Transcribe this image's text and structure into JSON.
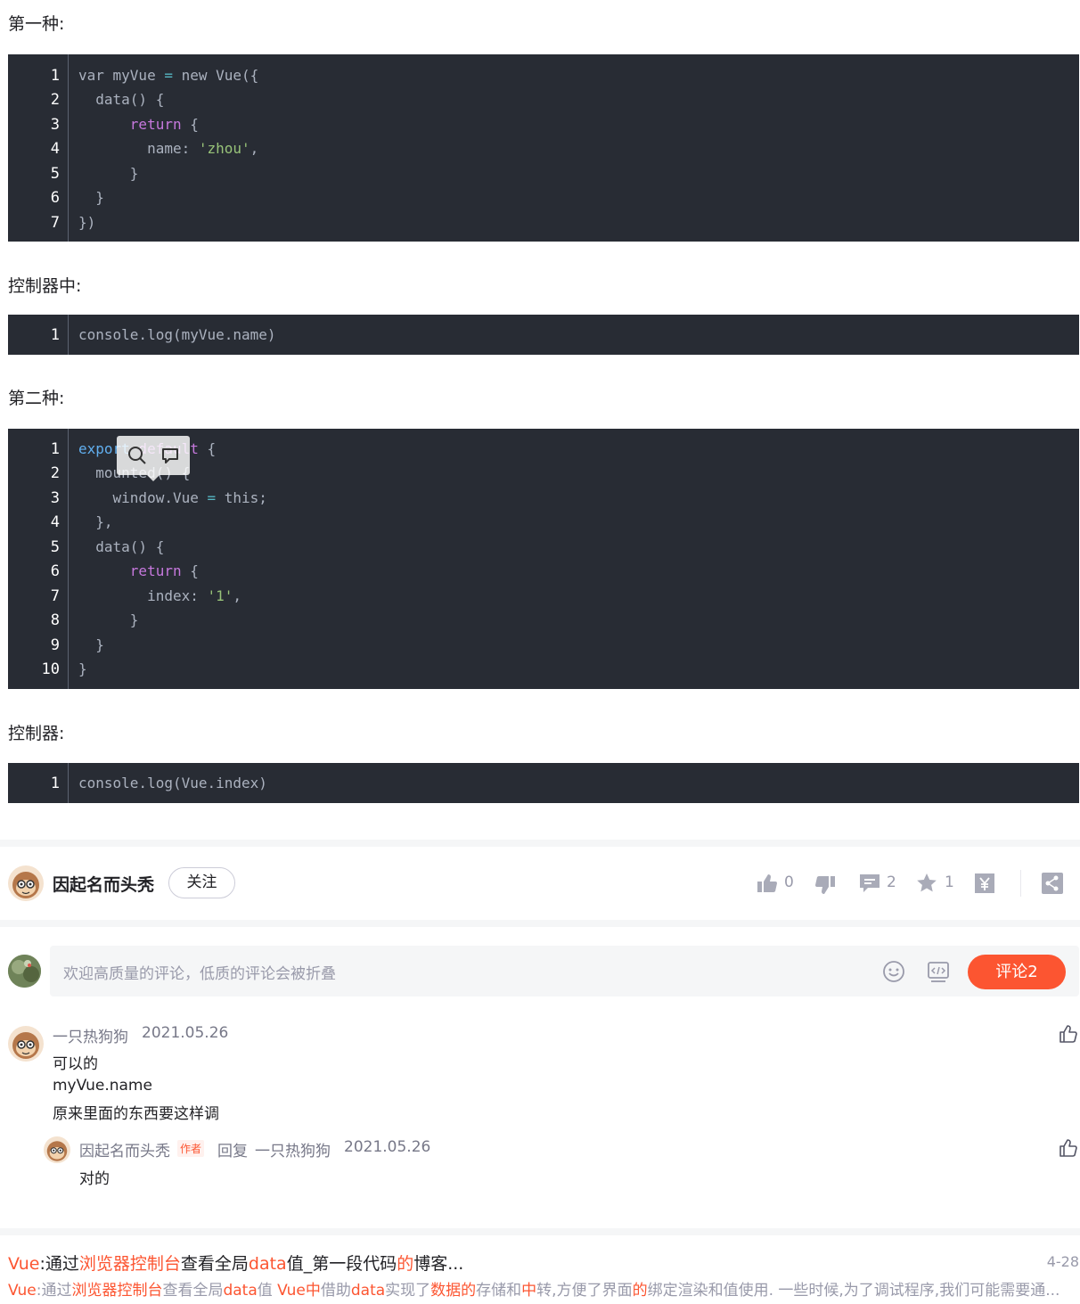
{
  "paragraphs": {
    "p1": "第一种:",
    "p2": "控制器中:",
    "p3": "第二种:",
    "p4": "控制器:"
  },
  "code_blocks": [
    {
      "lines": [
        "1",
        "2",
        "3",
        "4",
        "5",
        "6",
        "7"
      ]
    },
    {
      "lines": [
        "1"
      ]
    },
    {
      "lines": [
        "1",
        "2",
        "3",
        "4",
        "5",
        "6",
        "7",
        "8",
        "9",
        "10"
      ]
    },
    {
      "lines": [
        "1"
      ]
    }
  ],
  "code_text": {
    "b1": {
      "l1a": "var myVue ",
      "l1b": "=",
      "l1c": " new Vue({",
      "l2": "  data() {",
      "l3a": "      ",
      "l3b": "return",
      "l3c": " {",
      "l4a": "        name: ",
      "l4b": "'zhou'",
      "l4c": ",",
      "l5": "      }",
      "l6": "  }",
      "l7": "})"
    },
    "b2": {
      "l1": "console.log(myVue.name)"
    },
    "b3": {
      "l1a": "export",
      "l1b": " default",
      "l1c": " {",
      "l2": "  mounted() {",
      "l3a": "    window.Vue ",
      "l3b": "=",
      "l3c": " this;",
      "l4": "  },",
      "l5": "  data() {",
      "l6a": "      ",
      "l6b": "return",
      "l6c": " {",
      "l7a": "        index: ",
      "l7b": "'1'",
      "l7c": ",",
      "l8": "      }",
      "l9": "  }",
      "l10": "}"
    },
    "b4": {
      "l1": "console.log(Vue.index)"
    }
  },
  "author": {
    "name": "因起名而头秃",
    "follow_label": "关注"
  },
  "toolbar": {
    "like_count": "0",
    "comment_count": "2",
    "collect_count": "1",
    "icons": [
      "thumbs-up-icon",
      "thumbs-down-icon",
      "comment-icon",
      "star-icon",
      "reward-icon",
      "share-icon"
    ]
  },
  "comment_box": {
    "placeholder": "欢迎高质量的评论，低质的评论会被折叠",
    "submit_label": "评论2"
  },
  "comments": [
    {
      "user": "一只热狗狗",
      "date": "2021.05.26",
      "lines": [
        "可以的",
        "myVue.name",
        "原来里面的东西要这样调"
      ]
    }
  ],
  "reply": {
    "user": "因起名而头秃",
    "badge": "作者",
    "reply_word": "回复",
    "reply_to": "一只热狗狗",
    "date": "2021.05.26",
    "text": "对的"
  },
  "recommendation": {
    "title_parts": [
      "Vue",
      ":通过",
      "浏览器控制台",
      "查看全局",
      "data",
      "值_第一段代码",
      "的",
      "博客..."
    ],
    "desc_parts": [
      "Vue",
      ":通过",
      "浏览器控制台",
      "查看全局",
      "data",
      "值 ",
      "Vue中",
      "借助",
      "data",
      "实现了",
      "数据的",
      "存储和",
      "中",
      "转,方便了界面",
      "的",
      "绑定渲染和值使用. 一些时候,为了调试程序,我们可能需要通..."
    ],
    "date": "4-28"
  },
  "colors": {
    "accent": "#fc5531",
    "code_bg": "#282c34",
    "keyword": "#c678dd",
    "string": "#98c379",
    "export_kw": "#61afef"
  }
}
